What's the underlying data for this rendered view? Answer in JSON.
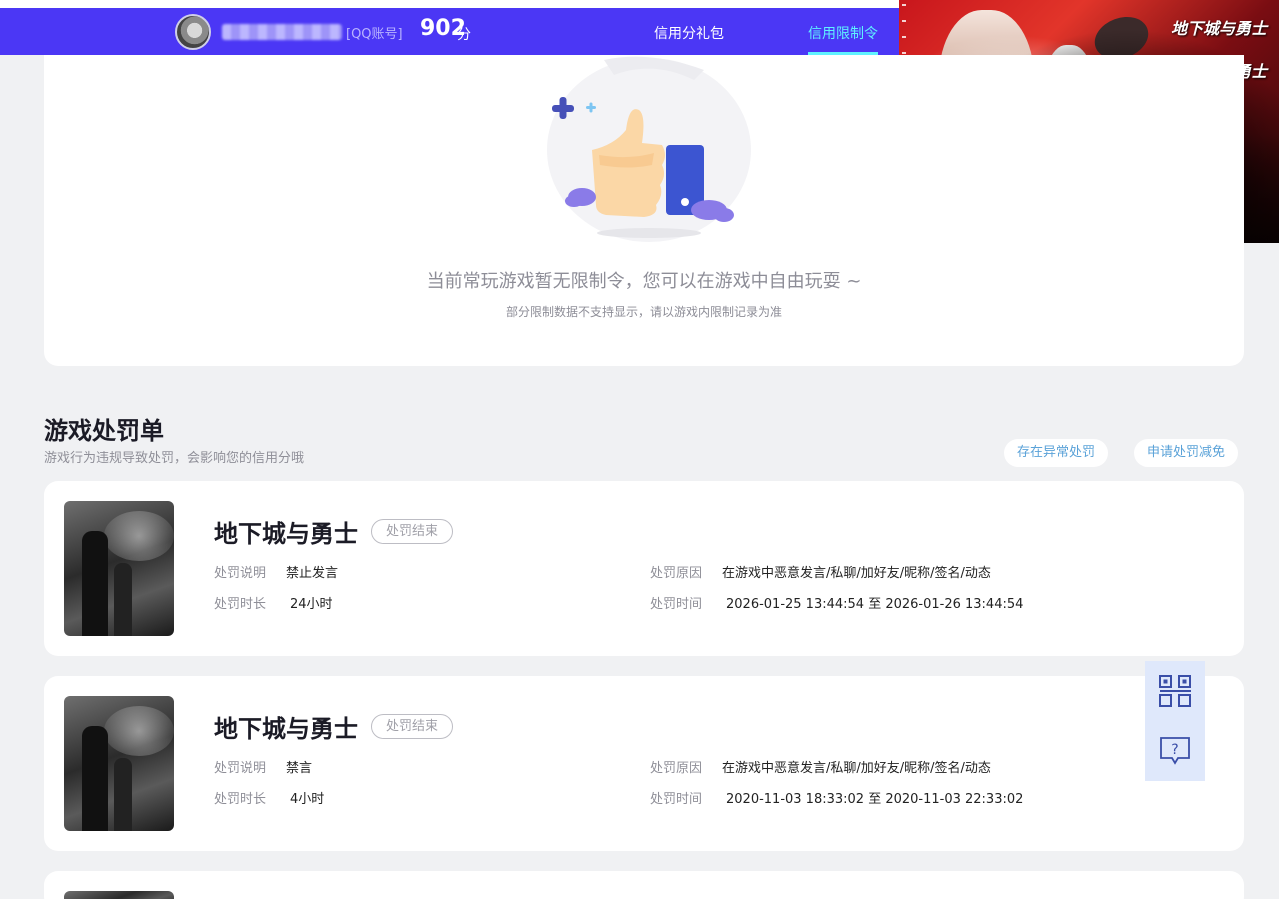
{
  "header": {
    "qq_tag": "[QQ账号]",
    "score": "902",
    "score_unit": "分",
    "nav": [
      {
        "label": "信用分礼包",
        "active": false
      },
      {
        "label": "信用限制令",
        "active": true
      }
    ]
  },
  "game_art": {
    "logo_lines": [
      "地下城与勇士",
      "地下城与勇士"
    ]
  },
  "restriction": {
    "message": "当前常玩游戏暂无限制令，您可以在游戏中自由玩耍 ~",
    "sub_message": "部分限制数据不支持显示，请以游戏内限制记录为准"
  },
  "penalties": {
    "title": "游戏处罚单",
    "subtitle": "游戏行为违规导致处罚，会影响您的信用分哦",
    "buttons": {
      "abnormal": "存在异常处罚",
      "reduce": "申请处罚减免"
    },
    "labels": {
      "desc": "处罚说明",
      "duration": "处罚时长",
      "reason": "处罚原因",
      "time": "处罚时间"
    },
    "items": [
      {
        "game": "地下城与勇士",
        "status": "处罚结束",
        "desc": "禁止发言",
        "duration": "24小时",
        "reason": "在游戏中恶意发言/私聊/加好友/昵称/签名/动态",
        "time": "2026-01-25 13:44:54 至 2026-01-26 13:44:54"
      },
      {
        "game": "地下城与勇士",
        "status": "处罚结束",
        "desc": "禁言",
        "duration": "4小时",
        "reason": "在游戏中恶意发言/私聊/加好友/昵称/签名/动态",
        "time": "2020-11-03 18:33:02 至 2020-11-03 22:33:02"
      }
    ]
  },
  "side_tools": [
    {
      "icon": "qr-code-icon"
    },
    {
      "icon": "help-chat-icon"
    }
  ],
  "colors": {
    "header_bg": "#4b37f5",
    "active_nav": "#5ff2ff",
    "link_blue": "#5aa2d8",
    "page_bg": "#f0f1f3"
  }
}
